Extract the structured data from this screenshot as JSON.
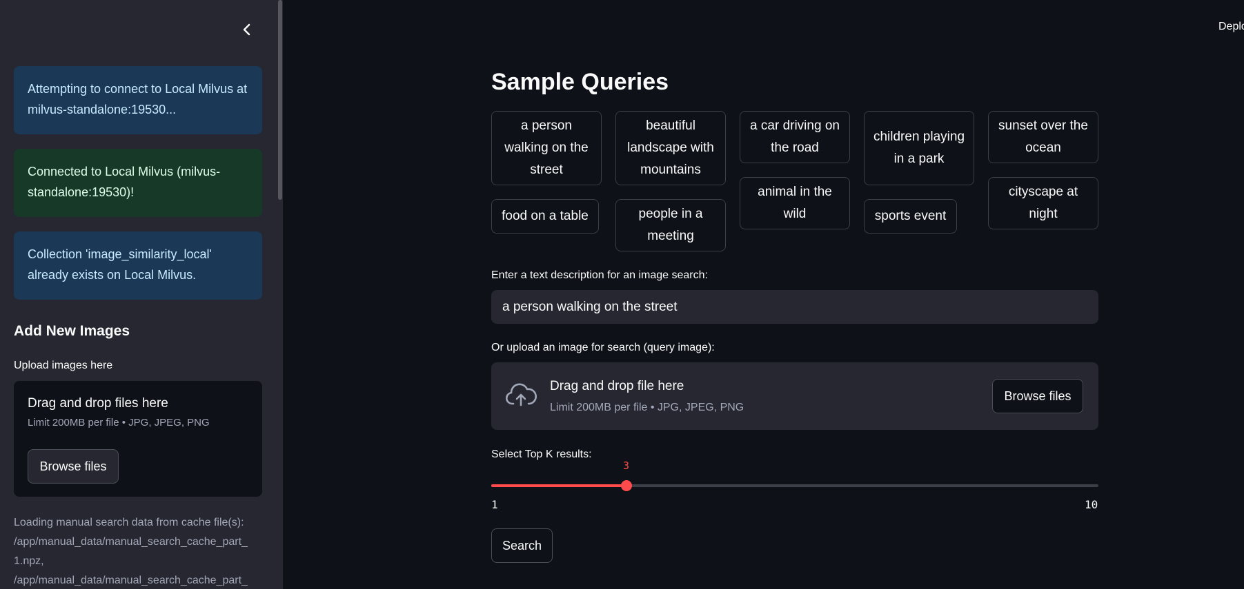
{
  "header": {
    "deploy_label": "Deplo"
  },
  "sidebar": {
    "alerts": [
      {
        "kind": "info",
        "text": "Attempting to connect to Local Milvus at milvus-standalone:19530..."
      },
      {
        "kind": "success",
        "text": "Connected to Local Milvus (milvus-standalone:19530)!"
      },
      {
        "kind": "info",
        "text": "Collection 'image_similarity_local' already exists on Local Milvus."
      }
    ],
    "add_images_heading": "Add New Images",
    "upload_label": "Upload images here",
    "uploader": {
      "drag_text": "Drag and drop files here",
      "limit_text": "Limit 200MB per file • JPG, JPEG, PNG",
      "browse_label": "Browse files"
    },
    "log_lines": [
      "Loading manual search data from cache file(s):",
      "/app/manual_data/manual_search_cache_part_",
      "1.npz,",
      "/app/manual_data/manual_search_cache_part_"
    ]
  },
  "main": {
    "title": "Sample Queries",
    "sample_queries": [
      "a person walking on the street",
      "beautiful landscape with mountains",
      "a car driving on the road",
      "children playing in a park",
      "sunset over the ocean",
      "food on a table",
      "people in a meeting",
      "animal in the wild",
      "sports event",
      "cityscape at night"
    ],
    "text_search_label": "Enter a text description for an image search:",
    "text_search_value": "a person walking on the street",
    "image_upload_label": "Or upload an image for search (query image):",
    "uploader": {
      "drag_text": "Drag and drop file here",
      "limit_text": "Limit 200MB per file • JPG, JPEG, PNG",
      "browse_label": "Browse files"
    },
    "topk": {
      "label": "Select Top K results:",
      "min": 1,
      "max": 10,
      "value": 3
    },
    "search_label": "Search"
  },
  "colors": {
    "background": "#0e1117",
    "sidebar": "#262730",
    "accent": "#ff4b4b",
    "info": "#1c3857",
    "success": "#173928"
  },
  "icons": [
    "chevron-left-icon",
    "cloud-upload-icon"
  ]
}
